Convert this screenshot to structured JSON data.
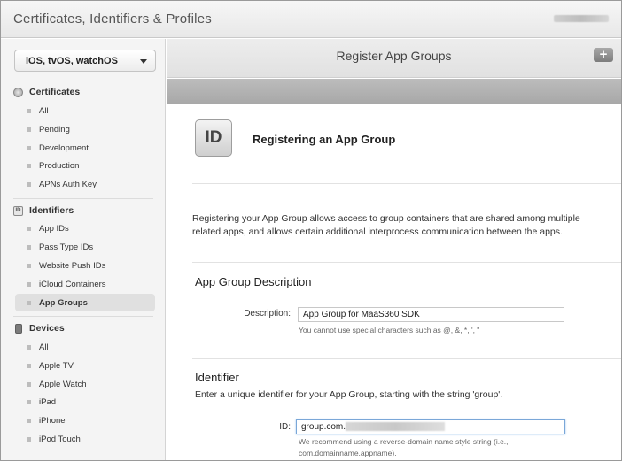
{
  "app": {
    "title": "Certificates, Identifiers & Profiles"
  },
  "sidebar": {
    "platform_select": {
      "selected": "iOS, tvOS, watchOS"
    },
    "sections": {
      "certificates": {
        "header": "Certificates",
        "items": [
          "All",
          "Pending",
          "Development",
          "Production",
          "APNs Auth Key"
        ]
      },
      "identifiers": {
        "header": "Identifiers",
        "items": [
          "App IDs",
          "Pass Type IDs",
          "Website Push IDs",
          "iCloud Containers",
          "App Groups"
        ],
        "active": "App Groups"
      },
      "devices": {
        "header": "Devices",
        "items": [
          "All",
          "Apple TV",
          "Apple Watch",
          "iPad",
          "iPhone",
          "iPod Touch"
        ]
      }
    }
  },
  "main": {
    "header_title": "Register App Groups",
    "add_button_label": "+",
    "badge_text": "ID",
    "page_heading": "Registering an App Group",
    "intro": "Registering your App Group allows access to group containers that are shared among multiple related apps, and allows certain additional interprocess communication between the apps.",
    "description_section": {
      "title": "App Group Description",
      "label": "Description:",
      "value": "App Group for MaaS360 SDK",
      "help": "You cannot use special characters such as @, &, *, ', \""
    },
    "identifier_section": {
      "title": "Identifier",
      "subtitle": "Enter a unique identifier for your App Group, starting with the string 'group'.",
      "label": "ID:",
      "value_prefix": "group.com.",
      "help_line1": "We recommend using a reverse-domain name style string (i.e.,",
      "help_line2": "com.domainname.appname)."
    }
  }
}
